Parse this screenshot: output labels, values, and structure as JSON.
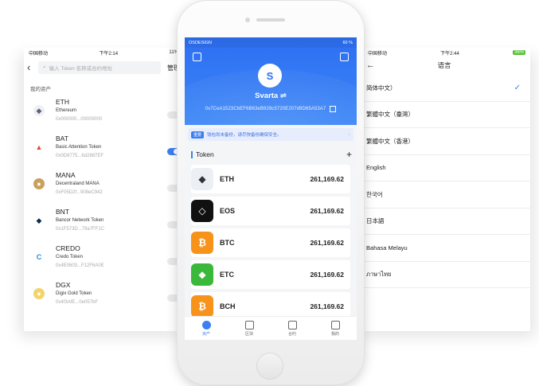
{
  "left": {
    "status_left": "中国移动",
    "status_time": "下午2:14",
    "status_right": "11%",
    "search_placeholder": "输入 Token 名称或合约地址",
    "manage_label": "管理",
    "section_title": "我的资产",
    "assets": [
      {
        "symbol": "ETH",
        "name": "Ethereum",
        "address": "0x000000...00000000",
        "toggle": "off"
      },
      {
        "symbol": "BAT",
        "name": "Basic Attention Token",
        "address": "0x0D8775...6d2887EF",
        "toggle": "on"
      },
      {
        "symbol": "MANA",
        "name": "Decentraland MANA",
        "address": "0xF05D2f...908eC942",
        "toggle": "off"
      },
      {
        "symbol": "BNT",
        "name": "Bancor Network Token",
        "address": "0x1F573D...79a7FF1C",
        "toggle": "off"
      },
      {
        "symbol": "CREDO",
        "name": "Credo Token",
        "address": "0x4E0603...F12F6A0E",
        "toggle": "off"
      },
      {
        "symbol": "DGX",
        "name": "Digix Gold Token",
        "address": "0x4f3AfE...0e057bF",
        "toggle": "off"
      }
    ]
  },
  "center": {
    "status_left": "OSDESIGN",
    "status_right": "60 %",
    "avatar_letter": "S",
    "wallet_name": "Svarta ⇌",
    "wallet_address": "0x7CeA1523CbEF6B63eB929c5720E207d9D65A53A7",
    "notice_tag": "重要",
    "notice_text": "钱包尚未备份，请尽快备份确保安全。",
    "token_section_title": "Token",
    "add_symbol": "+",
    "tokens": [
      {
        "symbol": "ETH",
        "value": "261,169.62",
        "icon_color": "#eceff3",
        "glyph": "◆",
        "glyph_color": "#333"
      },
      {
        "symbol": "EOS",
        "value": "261,169.62",
        "icon_color": "#111111",
        "glyph": "◇",
        "glyph_color": "#fff"
      },
      {
        "symbol": "BTC",
        "value": "261,169.62",
        "icon_color": "#f7931a",
        "glyph": "₿",
        "glyph_color": "#fff"
      },
      {
        "symbol": "ETC",
        "value": "261,169.62",
        "icon_color": "#3ab83a",
        "glyph": "◆",
        "glyph_color": "#fff"
      },
      {
        "symbol": "BCH",
        "value": "261,169.62",
        "icon_color": "#f7931a",
        "glyph": "₿",
        "glyph_color": "#fff"
      }
    ],
    "tabs": [
      {
        "label": "资产",
        "icon": "wallet-icon",
        "active": true
      },
      {
        "label": "区块",
        "icon": "block-icon",
        "active": false
      },
      {
        "label": "合约",
        "icon": "contract-icon",
        "active": false
      },
      {
        "label": "我的",
        "icon": "user-icon",
        "active": false
      }
    ]
  },
  "right": {
    "status_left": "中国移动",
    "status_time": "下午2:44",
    "status_right": "36%",
    "title": "语言",
    "languages": [
      {
        "label": "简体中文）",
        "selected": true
      },
      {
        "label": "繁體中文（臺灣）",
        "selected": false
      },
      {
        "label": "繁體中文（香港）",
        "selected": false
      },
      {
        "label": "English",
        "selected": false
      },
      {
        "label": "한국어",
        "selected": false
      },
      {
        "label": "日本語",
        "selected": false
      },
      {
        "label": "Bahasa Melayu",
        "selected": false
      },
      {
        "label": "ภาษาไทย",
        "selected": false
      }
    ]
  },
  "colors": {
    "accent": "#3d7ff0",
    "hero": "#2e6ff2"
  }
}
